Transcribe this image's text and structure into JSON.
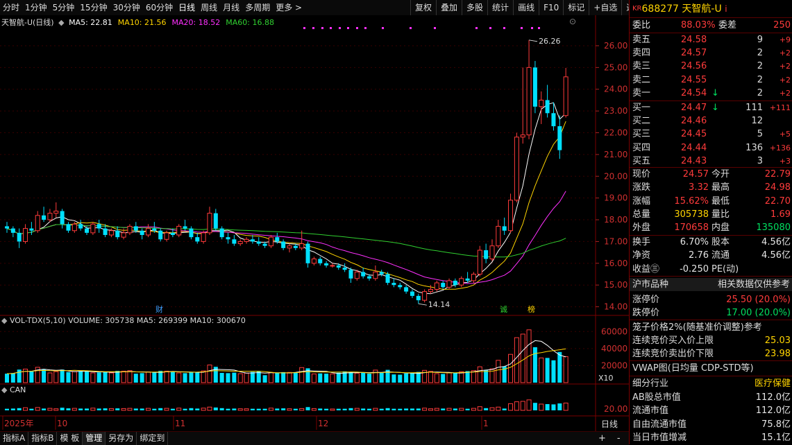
{
  "toolbar": {
    "periods": [
      "分时",
      "1分钟",
      "5分钟",
      "15分钟",
      "30分钟",
      "60分钟",
      "日线",
      "周线",
      "月线",
      "多周期",
      "更多 >"
    ],
    "tools": [
      "复权",
      "叠加",
      "多股",
      "统计",
      "画线",
      "F10",
      "标记",
      "+自选",
      "返回"
    ]
  },
  "main_chart": {
    "title": "天智航-U(日线)",
    "ma_labels": [
      {
        "text": "MA5: 22.81",
        "color": "#ffffff"
      },
      {
        "text": "MA10: 21.56",
        "color": "#ffd400"
      },
      {
        "text": "MA20: 18.52",
        "color": "#ff30ff"
      },
      {
        "text": "MA60: 16.88",
        "color": "#30d030"
      }
    ],
    "high_label": "26.26",
    "low_label": "14.14",
    "y_ticks": [
      "26.00",
      "25.00",
      "24.00",
      "23.00",
      "22.00",
      "21.00",
      "20.00",
      "19.00",
      "18.00",
      "17.00",
      "16.00",
      "15.00",
      "14.00"
    ],
    "markers": [
      {
        "text": "财",
        "color": "#3fa0ff"
      },
      {
        "text": "诚",
        "color": "#30d030"
      },
      {
        "text": "榜",
        "color": "#ffd400"
      }
    ]
  },
  "volume_chart": {
    "label": "VOL-TDX(5,10)  VOLUME: 305738  MA5: 269399  MA10: 300670",
    "y_ticks": [
      "60000",
      "40000",
      "20000"
    ],
    "unit": "X10"
  },
  "can_chart": {
    "label": "CAN",
    "y_tick": "20.00"
  },
  "x_axis": {
    "labels": [
      "2025年",
      "10",
      "11",
      "12",
      "1"
    ],
    "right_label": "日线",
    "buttons": [
      "+",
      "-"
    ]
  },
  "bottom_tabs": [
    "指标A",
    "指标B",
    "模 板",
    "管理",
    "另存为",
    "绑定到"
  ],
  "chart_data": {
    "type": "candlestick",
    "y_range": [
      13.7,
      26.7
    ],
    "candles": [
      [
        17.7,
        17.9,
        17.4,
        17.6
      ],
      [
        17.6,
        17.7,
        17.2,
        17.4
      ],
      [
        17.4,
        17.6,
        16.7,
        17.0
      ],
      [
        17.0,
        17.8,
        16.9,
        17.6
      ],
      [
        17.6,
        17.9,
        17.3,
        17.5
      ],
      [
        17.5,
        18.4,
        17.4,
        18.2
      ],
      [
        18.2,
        18.6,
        17.9,
        18.0
      ],
      [
        18.0,
        18.5,
        17.9,
        18.3
      ],
      [
        18.3,
        18.8,
        18.1,
        18.4
      ],
      [
        18.4,
        18.5,
        17.6,
        17.8
      ],
      [
        17.8,
        17.9,
        17.4,
        17.5
      ],
      [
        17.5,
        17.9,
        17.4,
        17.8
      ],
      [
        17.8,
        18.0,
        17.5,
        17.6
      ],
      [
        17.6,
        17.7,
        17.3,
        17.4
      ],
      [
        17.4,
        17.9,
        17.3,
        17.8
      ],
      [
        17.8,
        18.0,
        17.4,
        17.6
      ],
      [
        17.6,
        17.8,
        17.2,
        17.3
      ],
      [
        17.3,
        17.6,
        17.2,
        17.5
      ],
      [
        17.5,
        17.7,
        17.1,
        17.2
      ],
      [
        17.2,
        17.6,
        17.1,
        17.4
      ],
      [
        17.4,
        17.8,
        17.3,
        17.7
      ],
      [
        17.7,
        17.9,
        17.4,
        17.5
      ],
      [
        17.5,
        17.6,
        17.1,
        17.3
      ],
      [
        17.3,
        17.8,
        17.2,
        17.6
      ],
      [
        17.6,
        17.9,
        17.4,
        17.5
      ],
      [
        17.5,
        17.6,
        17.0,
        17.1
      ],
      [
        17.1,
        17.5,
        17.0,
        17.4
      ],
      [
        17.4,
        17.6,
        17.2,
        17.3
      ],
      [
        17.3,
        17.8,
        17.2,
        17.7
      ],
      [
        17.7,
        18.0,
        17.5,
        17.6
      ],
      [
        17.6,
        17.7,
        17.1,
        17.2
      ],
      [
        17.2,
        17.4,
        16.9,
        17.0
      ],
      [
        17.0,
        17.5,
        16.9,
        17.4
      ],
      [
        17.4,
        18.6,
        17.3,
        18.3
      ],
      [
        18.3,
        18.5,
        17.5,
        17.6
      ],
      [
        17.6,
        17.7,
        17.1,
        17.2
      ],
      [
        17.2,
        17.4,
        16.9,
        17.1
      ],
      [
        17.1,
        17.3,
        16.8,
        16.9
      ],
      [
        16.9,
        17.1,
        16.8,
        17.0
      ],
      [
        17.0,
        17.2,
        16.9,
        17.1
      ],
      [
        17.1,
        17.3,
        16.9,
        17.0
      ],
      [
        17.0,
        17.2,
        16.8,
        16.9
      ],
      [
        16.9,
        17.0,
        16.7,
        16.8
      ],
      [
        16.8,
        17.3,
        16.7,
        17.2
      ],
      [
        17.2,
        17.4,
        16.9,
        17.0
      ],
      [
        17.0,
        17.1,
        16.6,
        16.7
      ],
      [
        16.7,
        16.9,
        16.5,
        16.8
      ],
      [
        16.8,
        16.9,
        16.6,
        16.7
      ],
      [
        16.7,
        17.5,
        16.6,
        16.9
      ],
      [
        16.9,
        17.0,
        15.8,
        16.0
      ],
      [
        16.0,
        16.3,
        15.9,
        16.2
      ],
      [
        16.2,
        16.3,
        15.9,
        16.0
      ],
      [
        16.0,
        16.1,
        15.8,
        15.9
      ],
      [
        15.9,
        16.0,
        15.8,
        15.9
      ],
      [
        15.9,
        16.0,
        15.7,
        15.8
      ],
      [
        15.8,
        16.0,
        15.6,
        15.7
      ],
      [
        15.7,
        15.8,
        15.1,
        15.3
      ],
      [
        15.3,
        15.7,
        15.2,
        15.6
      ],
      [
        15.6,
        15.8,
        15.3,
        15.4
      ],
      [
        15.4,
        15.5,
        15.2,
        15.3
      ],
      [
        15.3,
        15.9,
        15.2,
        15.6
      ],
      [
        15.6,
        15.7,
        15.4,
        15.5
      ],
      [
        15.5,
        15.6,
        15.0,
        15.1
      ],
      [
        15.1,
        15.3,
        14.9,
        15.0
      ],
      [
        15.0,
        15.1,
        14.8,
        14.9
      ],
      [
        14.9,
        15.0,
        14.6,
        14.7
      ],
      [
        14.7,
        14.8,
        14.4,
        14.5
      ],
      [
        14.5,
        14.6,
        14.14,
        14.3
      ],
      [
        14.3,
        14.8,
        14.2,
        14.7
      ],
      [
        14.7,
        15.0,
        14.6,
        14.8
      ],
      [
        14.8,
        15.2,
        14.7,
        15.1
      ],
      [
        15.1,
        15.2,
        14.8,
        14.9
      ],
      [
        14.9,
        15.3,
        14.8,
        15.2
      ],
      [
        15.2,
        15.3,
        14.9,
        15.0
      ],
      [
        15.0,
        15.4,
        14.9,
        15.3
      ],
      [
        15.3,
        15.6,
        15.1,
        15.2
      ],
      [
        15.2,
        15.6,
        15.1,
        15.5
      ],
      [
        15.5,
        16.8,
        15.4,
        16.6
      ],
      [
        16.6,
        16.9,
        16.0,
        16.2
      ],
      [
        16.2,
        17.1,
        16.1,
        16.8
      ],
      [
        16.8,
        18.0,
        16.7,
        17.7
      ],
      [
        17.7,
        18.1,
        17.3,
        17.5
      ],
      [
        17.5,
        19.2,
        17.4,
        18.9
      ],
      [
        18.9,
        22.0,
        18.8,
        21.8
      ],
      [
        21.8,
        25.0,
        21.5,
        21.9
      ],
      [
        21.9,
        26.26,
        21.7,
        25.0
      ],
      [
        25.0,
        25.3,
        22.9,
        23.2
      ],
      [
        23.2,
        23.9,
        22.4,
        23.5
      ],
      [
        23.5,
        24.2,
        22.7,
        22.9
      ],
      [
        22.9,
        23.4,
        22.1,
        22.3
      ],
      [
        22.3,
        22.8,
        20.8,
        21.2
      ],
      [
        22.79,
        24.98,
        22.7,
        24.57
      ]
    ],
    "volume_y_range": [
      0,
      70000
    ],
    "ma_series": [
      {
        "name": "MA5",
        "color": "#ffffff"
      },
      {
        "name": "MA10",
        "color": "#ffd400"
      },
      {
        "name": "MA20",
        "color": "#ff30ff"
      },
      {
        "name": "MA60",
        "color": "#30d030"
      }
    ]
  },
  "panel": {
    "code_prefix": "KR",
    "code": "688277",
    "name": "天智航-U",
    "suffix": "i",
    "webi_label": "委比",
    "webi_value": "88.03%",
    "weicha_label": "委差",
    "weicha_value": "250",
    "asks": [
      {
        "label": "卖五",
        "price": "24.58",
        "vol": "9",
        "chg": "+9",
        "arrow": ""
      },
      {
        "label": "卖四",
        "price": "24.57",
        "vol": "2",
        "chg": "+2",
        "arrow": ""
      },
      {
        "label": "卖三",
        "price": "24.56",
        "vol": "2",
        "chg": "+2",
        "arrow": ""
      },
      {
        "label": "卖二",
        "price": "24.55",
        "vol": "2",
        "chg": "+2",
        "arrow": ""
      },
      {
        "label": "卖一",
        "price": "24.54",
        "vol": "2",
        "chg": "+2",
        "arrow": "↓"
      }
    ],
    "bids": [
      {
        "label": "买一",
        "price": "24.47",
        "vol": "111",
        "chg": "+111",
        "arrow": "↓"
      },
      {
        "label": "买二",
        "price": "24.46",
        "vol": "12",
        "chg": "",
        "arrow": ""
      },
      {
        "label": "买三",
        "price": "24.45",
        "vol": "5",
        "chg": "+5",
        "arrow": ""
      },
      {
        "label": "买四",
        "price": "24.44",
        "vol": "136",
        "chg": "+136",
        "arrow": ""
      },
      {
        "label": "买五",
        "price": "24.43",
        "vol": "3",
        "chg": "+3",
        "arrow": ""
      }
    ],
    "quotes": [
      {
        "l1": "现价",
        "v1": "24.57",
        "c1": "#ff3b3b",
        "l2": "今开",
        "v2": "22.79",
        "c2": "#ff3b3b"
      },
      {
        "l1": "涨跌",
        "v1": "3.32",
        "c1": "#ff3b3b",
        "l2": "最高",
        "v2": "24.98",
        "c2": "#ff3b3b"
      },
      {
        "l1": "涨幅",
        "v1": "15.62%",
        "c1": "#ff3b3b",
        "l2": "最低",
        "v2": "22.70",
        "c2": "#ff3b3b"
      },
      {
        "l1": "总量",
        "v1": "305738",
        "c1": "#ffd400",
        "l2": "量比",
        "v2": "1.69",
        "c2": "#ff3b3b"
      },
      {
        "l1": "外盘",
        "v1": "170658",
        "c1": "#ff3b3b",
        "l2": "内盘",
        "v2": "135080",
        "c2": "#00e060"
      }
    ],
    "stats": [
      {
        "l1": "换手",
        "v1": "6.70%",
        "l2": "股本",
        "v2": "4.56亿"
      },
      {
        "l1": "净资",
        "v1": "2.76",
        "l2": "流通",
        "v2": "4.56亿"
      },
      {
        "l1": "收益㊂",
        "v1": "-0.250",
        "l2": "PE(动)",
        "v2": ""
      }
    ],
    "market_label": "沪市品种",
    "market_note": "相关数据仅供参考",
    "limit_up_label": "涨停价",
    "limit_up_value": "25.50 (20.0%)",
    "limit_down_label": "跌停价",
    "limit_down_value": "17.00 (20.0%)",
    "cage_text": "笼子价格2%(随基准价调整)参考",
    "bid_upper_label": "连续竞价买入价上限",
    "bid_upper_value": "25.03",
    "ask_lower_label": "连续竞价卖出价下限",
    "ask_lower_value": "23.98",
    "vwap_text": "VWAP图(日均量 CDP-STD等)",
    "industry_label": "细分行业",
    "industry_value": "医疗保健",
    "caps": [
      {
        "label": "AB股总市值",
        "value": "112.0亿"
      },
      {
        "label": "流通市值",
        "value": "112.0亿"
      },
      {
        "label": "自由流通市值",
        "value": "75.8亿"
      },
      {
        "label": "当日市值增减",
        "value": "15.1亿"
      }
    ]
  }
}
